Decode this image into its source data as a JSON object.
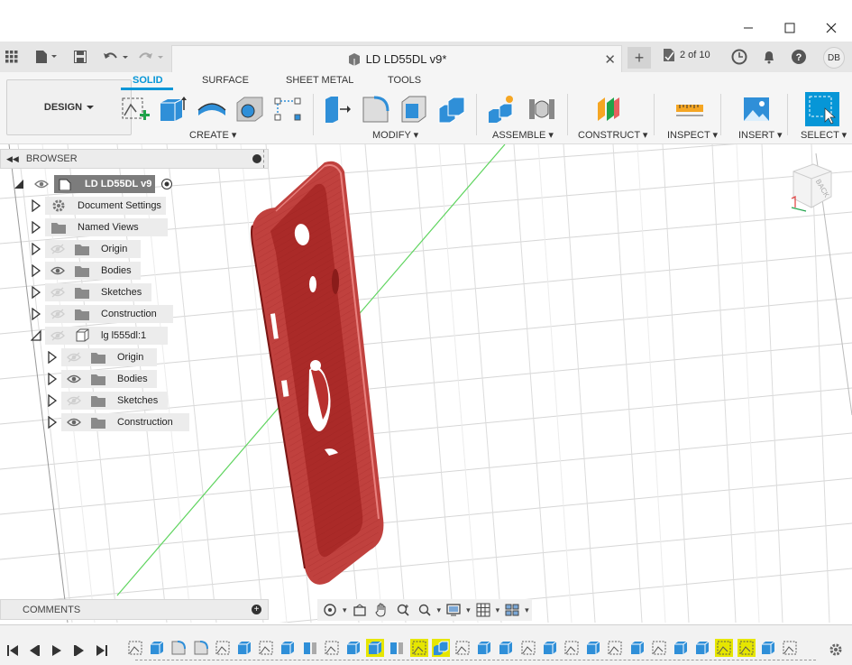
{
  "window": {
    "minimize_label": "—",
    "maximize_label": "☐",
    "close_label": "✕"
  },
  "tabbar": {
    "document_title": "LD LD55DL v9*",
    "close_tab": "✕",
    "new_tab": "+",
    "job_status": "2 of 10",
    "user_initials": "DB"
  },
  "workspace": {
    "mode_label": "DESIGN",
    "tabs": [
      "SOLID",
      "SURFACE",
      "SHEET METAL",
      "TOOLS"
    ],
    "active_tab": "SOLID"
  },
  "toolbar_groups": {
    "create": "CREATE",
    "modify": "MODIFY",
    "assemble": "ASSEMBLE",
    "construct": "CONSTRUCT",
    "inspect": "INSPECT",
    "insert": "INSERT",
    "select": "SELECT"
  },
  "browser": {
    "header": "BROWSER",
    "root": "LD LD55DL v9",
    "items": [
      {
        "label": "Document Settings",
        "type": "settings",
        "eye": "none",
        "level": 0
      },
      {
        "label": "Named Views",
        "type": "folder",
        "eye": "none",
        "level": 0
      },
      {
        "label": "Origin",
        "type": "folder",
        "eye": "hidden",
        "level": 0
      },
      {
        "label": "Bodies",
        "type": "folder",
        "eye": "visible",
        "level": 0
      },
      {
        "label": "Sketches",
        "type": "folder",
        "eye": "hidden",
        "level": 0
      },
      {
        "label": "Construction",
        "type": "folder",
        "eye": "hidden",
        "level": 0
      },
      {
        "label": "lg l555dl:1",
        "type": "component",
        "eye": "hidden",
        "level": 0
      },
      {
        "label": "Origin",
        "type": "folder",
        "eye": "hidden",
        "level": 1
      },
      {
        "label": "Bodies",
        "type": "folder",
        "eye": "visible",
        "level": 1
      },
      {
        "label": "Sketches",
        "type": "folder",
        "eye": "hidden",
        "level": 1
      },
      {
        "label": "Construction",
        "type": "folder",
        "eye": "visible",
        "level": 1
      }
    ]
  },
  "viewcube": {
    "face_label": "BACK"
  },
  "comments": {
    "header": "COMMENTS",
    "add": "+"
  },
  "colors": {
    "accent": "#0696d7",
    "body_red": "#b8312f",
    "highlight": "#e6e600"
  }
}
